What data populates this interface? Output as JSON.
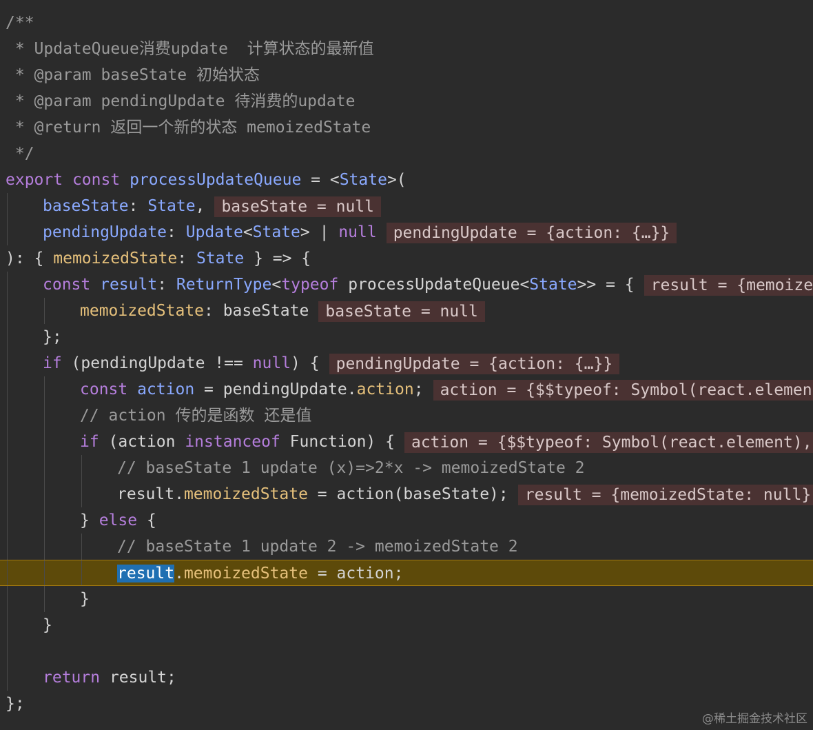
{
  "editor": {
    "lines": [
      {
        "indent": 0,
        "guides": [],
        "tokens": [
          {
            "t": "/**",
            "c": "comment"
          }
        ]
      },
      {
        "indent": 0,
        "guides": [],
        "tokens": [
          {
            "t": " * UpdateQueue消费update  计算状态的最新值",
            "c": "comment"
          }
        ]
      },
      {
        "indent": 0,
        "guides": [],
        "tokens": [
          {
            "t": " * @param baseState 初始状态",
            "c": "comment"
          }
        ]
      },
      {
        "indent": 0,
        "guides": [],
        "tokens": [
          {
            "t": " * @param pendingUpdate 待消费的update",
            "c": "comment"
          }
        ]
      },
      {
        "indent": 0,
        "guides": [],
        "tokens": [
          {
            "t": " * @return 返回一个新的状态 memoizedState",
            "c": "comment"
          }
        ]
      },
      {
        "indent": 0,
        "guides": [],
        "tokens": [
          {
            "t": " */",
            "c": "comment"
          }
        ]
      },
      {
        "indent": 0,
        "guides": [],
        "tokens": [
          {
            "t": "export",
            "c": "kw"
          },
          {
            "t": " ",
            "c": "plain"
          },
          {
            "t": "const",
            "c": "kw"
          },
          {
            "t": " ",
            "c": "plain"
          },
          {
            "t": "processUpdateQueue",
            "c": "fn"
          },
          {
            "t": " = <",
            "c": "plain"
          },
          {
            "t": "State",
            "c": "type"
          },
          {
            "t": ">(",
            "c": "plain"
          }
        ]
      },
      {
        "indent": 1,
        "guides": [
          1
        ],
        "tokens": [
          {
            "t": "baseState",
            "c": "fn"
          },
          {
            "t": ": ",
            "c": "plain"
          },
          {
            "t": "State",
            "c": "type"
          },
          {
            "t": ",",
            "c": "plain"
          }
        ],
        "hint": "baseState = null"
      },
      {
        "indent": 1,
        "guides": [
          1
        ],
        "tokens": [
          {
            "t": "pendingUpdate",
            "c": "fn"
          },
          {
            "t": ": ",
            "c": "plain"
          },
          {
            "t": "Update",
            "c": "type"
          },
          {
            "t": "<",
            "c": "plain"
          },
          {
            "t": "State",
            "c": "type"
          },
          {
            "t": "> | ",
            "c": "plain"
          },
          {
            "t": "null",
            "c": "kw"
          }
        ],
        "hint": "pendingUpdate = {action: {…}}"
      },
      {
        "indent": 0,
        "guides": [],
        "tokens": [
          {
            "t": "): { ",
            "c": "plain"
          },
          {
            "t": "memoizedState",
            "c": "prop"
          },
          {
            "t": ": ",
            "c": "plain"
          },
          {
            "t": "State",
            "c": "type"
          },
          {
            "t": " } => {",
            "c": "plain"
          }
        ]
      },
      {
        "indent": 1,
        "guides": [
          1
        ],
        "tokens": [
          {
            "t": "const",
            "c": "kw"
          },
          {
            "t": " ",
            "c": "plain"
          },
          {
            "t": "result",
            "c": "fn"
          },
          {
            "t": ": ",
            "c": "plain"
          },
          {
            "t": "ReturnType",
            "c": "type"
          },
          {
            "t": "<",
            "c": "plain"
          },
          {
            "t": "typeof",
            "c": "kw"
          },
          {
            "t": " processUpdateQueue<",
            "c": "plain"
          },
          {
            "t": "State",
            "c": "type"
          },
          {
            "t": ">> = {",
            "c": "plain"
          }
        ],
        "hint": "result = {memoizedState: null}"
      },
      {
        "indent": 2,
        "guides": [
          1,
          2
        ],
        "tokens": [
          {
            "t": "memoizedState",
            "c": "prop"
          },
          {
            "t": ": baseState",
            "c": "plain"
          }
        ],
        "hint": "baseState = null"
      },
      {
        "indent": 1,
        "guides": [
          1
        ],
        "tokens": [
          {
            "t": "};",
            "c": "plain"
          }
        ]
      },
      {
        "indent": 1,
        "guides": [
          1
        ],
        "tokens": [
          {
            "t": "if",
            "c": "kw"
          },
          {
            "t": " (pendingUpdate !== ",
            "c": "plain"
          },
          {
            "t": "null",
            "c": "kw"
          },
          {
            "t": ") {",
            "c": "plain"
          }
        ],
        "hint": "pendingUpdate = {action: {…}}"
      },
      {
        "indent": 2,
        "guides": [
          1,
          2
        ],
        "tokens": [
          {
            "t": "const",
            "c": "kw"
          },
          {
            "t": " ",
            "c": "plain"
          },
          {
            "t": "action",
            "c": "fn"
          },
          {
            "t": " = pendingUpdate.",
            "c": "plain"
          },
          {
            "t": "action",
            "c": "prop"
          },
          {
            "t": ";",
            "c": "plain"
          }
        ],
        "hint": "action = {$$typeof: Symbol(react.element), type: 'div'}"
      },
      {
        "indent": 2,
        "guides": [
          1,
          2
        ],
        "tokens": [
          {
            "t": "// action 传的是函数 还是值",
            "c": "comment"
          }
        ]
      },
      {
        "indent": 2,
        "guides": [
          1,
          2
        ],
        "tokens": [
          {
            "t": "if",
            "c": "kw"
          },
          {
            "t": " (action ",
            "c": "plain"
          },
          {
            "t": "instanceof",
            "c": "kw"
          },
          {
            "t": " Function) {",
            "c": "plain"
          }
        ],
        "hint": "action = {$$typeof: Symbol(react.element), type: 'div'}"
      },
      {
        "indent": 3,
        "guides": [
          1,
          2,
          3
        ],
        "tokens": [
          {
            "t": "// baseState 1 update (x)=>2*x -> memoizedState 2",
            "c": "comment"
          }
        ]
      },
      {
        "indent": 3,
        "guides": [
          1,
          2,
          3
        ],
        "tokens": [
          {
            "t": "result.",
            "c": "plain"
          },
          {
            "t": "memoizedState",
            "c": "prop"
          },
          {
            "t": " = action(baseState);",
            "c": "plain"
          }
        ],
        "hint": "result = {memoizedState: null}, baseState = null"
      },
      {
        "indent": 2,
        "guides": [
          1,
          2
        ],
        "tokens": [
          {
            "t": "} ",
            "c": "plain"
          },
          {
            "t": "else",
            "c": "kw"
          },
          {
            "t": " {",
            "c": "plain"
          }
        ]
      },
      {
        "indent": 3,
        "guides": [
          1,
          2,
          3
        ],
        "tokens": [
          {
            "t": "// baseState 1 update 2 -> memoizedState 2",
            "c": "comment"
          }
        ]
      },
      {
        "indent": 3,
        "guides": [
          1,
          2,
          3
        ],
        "current": true,
        "tokens": [
          {
            "t": "result",
            "c": "sel"
          },
          {
            "t": ".",
            "c": "plain"
          },
          {
            "t": "memoizedState",
            "c": "prop"
          },
          {
            "t": " = action;",
            "c": "plain"
          }
        ]
      },
      {
        "indent": 2,
        "guides": [
          1,
          2
        ],
        "tokens": [
          {
            "t": "}",
            "c": "plain"
          }
        ]
      },
      {
        "indent": 1,
        "guides": [
          1
        ],
        "tokens": [
          {
            "t": "}",
            "c": "plain"
          }
        ]
      },
      {
        "indent": 1,
        "guides": [
          1
        ],
        "tokens": []
      },
      {
        "indent": 1,
        "guides": [
          1
        ],
        "tokens": [
          {
            "t": "return",
            "c": "kw"
          },
          {
            "t": " result;",
            "c": "plain"
          }
        ]
      },
      {
        "indent": 0,
        "guides": [],
        "tokens": [
          {
            "t": "};",
            "c": "plain"
          }
        ]
      }
    ]
  },
  "watermark": "@稀土掘金技术社区"
}
